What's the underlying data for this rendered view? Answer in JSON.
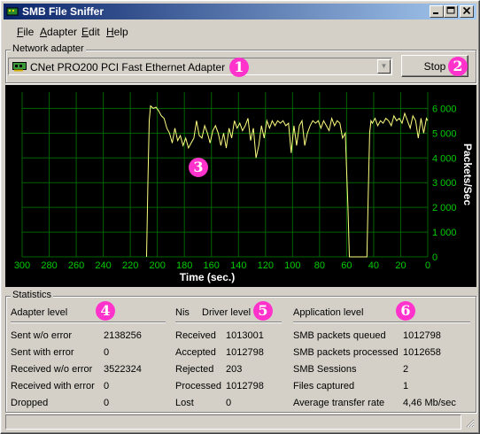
{
  "window": {
    "title": "SMB File Sniffer"
  },
  "menu": [
    {
      "label": "File",
      "key": "F",
      "rest": "ile"
    },
    {
      "label": "Adapter",
      "key": "A",
      "rest": "dapter"
    },
    {
      "label": "Edit",
      "key": "E",
      "rest": "dit"
    },
    {
      "label": "Help",
      "key": "H",
      "rest": "elp"
    }
  ],
  "adapter": {
    "group_label": "Network adapter",
    "selected": "CNet PRO200 PCI Fast Ethernet Adapter",
    "stop_label": "Stop"
  },
  "markers": [
    "1",
    "2",
    "3",
    "4",
    "5",
    "6"
  ],
  "chart_data": {
    "type": "line",
    "xlabel": "Time (sec.)",
    "ylabel": "Packets/Sec",
    "x_ticks": [
      300,
      280,
      260,
      240,
      220,
      200,
      180,
      160,
      140,
      120,
      100,
      80,
      60,
      40,
      20,
      0
    ],
    "y_ticks": [
      0,
      1000,
      2000,
      3000,
      4000,
      5000,
      6000
    ],
    "xlim": [
      300,
      0
    ],
    "ylim": [
      0,
      6300
    ],
    "grid": true,
    "colors": {
      "background": "#000000",
      "grid": "#006400",
      "line": "#ffff80",
      "ticks": "#00cc00"
    },
    "series": [
      {
        "x": [
          208,
          207,
          206,
          205,
          203,
          201,
          199,
          197,
          195,
          193,
          191,
          189,
          187,
          185,
          183,
          181,
          179,
          177,
          175,
          173,
          171,
          169,
          167,
          165,
          163,
          161,
          159,
          157,
          155,
          153,
          151,
          149,
          147,
          145,
          143,
          141,
          139,
          137,
          135,
          133,
          131,
          129,
          127,
          125,
          123,
          121,
          119,
          117,
          115,
          113,
          111,
          109,
          107,
          105,
          103,
          101,
          99,
          97,
          95,
          93,
          91,
          89,
          87,
          85,
          83,
          81,
          79,
          77,
          75,
          73,
          71,
          69,
          67,
          65,
          63,
          61,
          60,
          59,
          58,
          57,
          56,
          45,
          44,
          43,
          42,
          41,
          39,
          37,
          35,
          33,
          31,
          29,
          27,
          25,
          23,
          21,
          19,
          17,
          15,
          13,
          11,
          9,
          7,
          5,
          3,
          1,
          0
        ],
        "y": [
          0,
          3000,
          5500,
          6100,
          6000,
          6050,
          5900,
          5700,
          5600,
          5200,
          5000,
          4600,
          5200,
          4700,
          4900,
          4500,
          4800,
          4400,
          4600,
          4800,
          5500,
          4900,
          4800,
          5300,
          5000,
          4600,
          5100,
          5300,
          5000,
          4500,
          5000,
          4400,
          5200,
          4800,
          5500,
          5200,
          5400,
          5100,
          5300,
          5600,
          4700,
          5200,
          4000,
          4500,
          5300,
          4800,
          5500,
          5200,
          5500,
          5300,
          5500,
          5400,
          5500,
          5300,
          5400,
          4200,
          5300,
          4500,
          5300,
          5500,
          4500,
          5000,
          5300,
          5500,
          5400,
          5500,
          5200,
          5500,
          5300,
          5100,
          5600,
          5300,
          5500,
          5400,
          4800,
          5000,
          3500,
          2000,
          0,
          0,
          0,
          0,
          2500,
          5000,
          5500,
          5400,
          5600,
          5300,
          5500,
          5400,
          5600,
          5500,
          5300,
          5700,
          5500,
          5600,
          5400,
          5800,
          5500,
          5200,
          5700,
          5500,
          4800,
          5600,
          5000,
          5600,
          5500
        ]
      }
    ]
  },
  "stats": {
    "group_label": "Statistics",
    "adapter": {
      "header": "Adapter level",
      "rows": [
        {
          "label": "Sent w/o error",
          "value": "2138256"
        },
        {
          "label": "Sent with error",
          "value": "0"
        },
        {
          "label": "Received w/o error",
          "value": "3522324"
        },
        {
          "label": "Received with error",
          "value": "0"
        },
        {
          "label": "Dropped",
          "value": "0"
        }
      ]
    },
    "driver": {
      "header_prefix": "Nis",
      "header": "Driver level",
      "rows": [
        {
          "label": "Received",
          "value": "1013001"
        },
        {
          "label": "Accepted",
          "value": "1012798"
        },
        {
          "label": "Rejected",
          "value": "203"
        },
        {
          "label": "Processed",
          "value": "1012798"
        },
        {
          "label": "Lost",
          "value": "0"
        }
      ]
    },
    "application": {
      "header": "Application level",
      "rows": [
        {
          "label": "SMB packets queued",
          "value": "1012798"
        },
        {
          "label": "SMB packets processed",
          "value": "1012658"
        },
        {
          "label": "SMB Sessions",
          "value": "2"
        },
        {
          "label": "Files captured",
          "value": "1"
        },
        {
          "label": "Average transfer rate",
          "value": "4,46 Mb/sec"
        }
      ]
    }
  }
}
